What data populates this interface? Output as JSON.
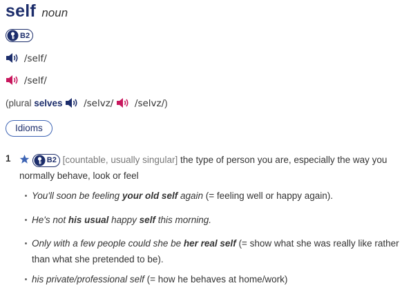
{
  "entry": {
    "headword": "self",
    "pos": "noun",
    "level": "B2",
    "pron_uk": "/self/",
    "pron_us": "/self/",
    "plural": {
      "open": "(plural ",
      "word": "selves",
      "pron_uk": "/selvz/",
      "pron_us": "/selvz/",
      "close": ")"
    },
    "idioms_label": "Idioms"
  },
  "colors": {
    "navy": "#1c2d6b",
    "speaker_uk": "#1c2d6b",
    "speaker_us": "#c8175d",
    "star": "#3d64b4"
  },
  "icons": {
    "badge_key": "oxford-key-icon",
    "speaker": "speaker-icon",
    "star": "star-icon"
  },
  "sense": {
    "number": "1",
    "level": "B2",
    "grammar": "[countable, usually singular]",
    "definition": "the type of person you are, especially the way you normally behave, look or feel"
  },
  "examples": [
    {
      "parts": [
        {
          "t": "You'll soon be feeling ",
          "b": false
        },
        {
          "t": "your old self",
          "b": true
        },
        {
          "t": " again",
          "b": false
        }
      ],
      "gloss": " (= feeling well or happy again)."
    },
    {
      "parts": [
        {
          "t": "He's not ",
          "b": false
        },
        {
          "t": "his usual",
          "b": true
        },
        {
          "t": " happy ",
          "b": false
        },
        {
          "t": "self",
          "b": true
        },
        {
          "t": " this morning.",
          "b": false
        }
      ],
      "gloss": ""
    },
    {
      "parts": [
        {
          "t": "Only with a few people could she be ",
          "b": false
        },
        {
          "t": "her real self",
          "b": true
        }
      ],
      "gloss": " (= show what she was really like rather than what she pretended to be)."
    },
    {
      "parts": [
        {
          "t": "his private/professional self",
          "b": false
        }
      ],
      "gloss": " (= how he behaves at home/work)"
    }
  ]
}
